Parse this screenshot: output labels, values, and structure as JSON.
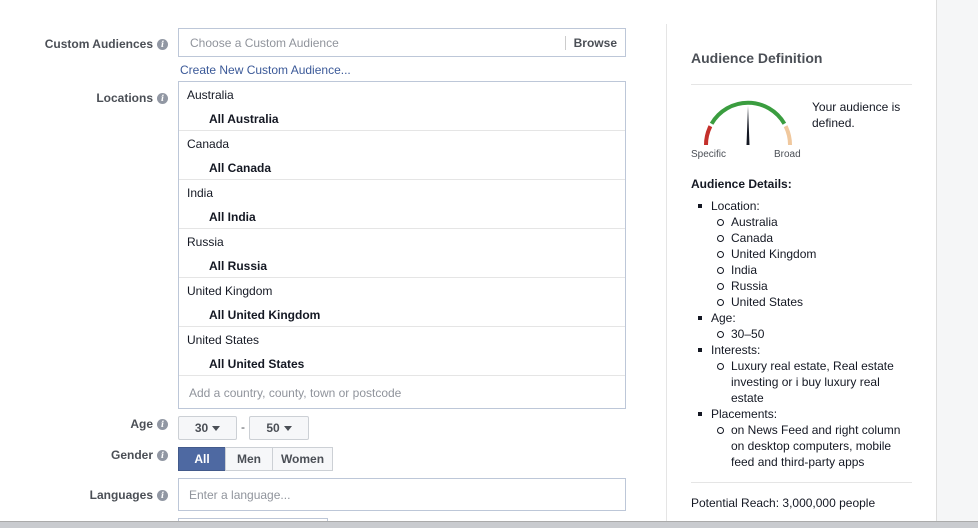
{
  "form": {
    "custom_audiences": {
      "label": "Custom Audiences",
      "placeholder": "Choose a Custom Audience",
      "browse_label": "Browse",
      "create_link": "Create New Custom Audience..."
    },
    "locations": {
      "label": "Locations",
      "groups": [
        {
          "country": "Australia",
          "scope": "All Australia"
        },
        {
          "country": "Canada",
          "scope": "All Canada"
        },
        {
          "country": "India",
          "scope": "All India"
        },
        {
          "country": "Russia",
          "scope": "All Russia"
        },
        {
          "country": "United Kingdom",
          "scope": "All United Kingdom"
        },
        {
          "country": "United States",
          "scope": "All United States"
        }
      ],
      "add_placeholder": "Add a country, county, town or postcode"
    },
    "age": {
      "label": "Age",
      "min": "30",
      "separator": "-",
      "max": "50"
    },
    "gender": {
      "label": "Gender",
      "options": [
        "All",
        "Men",
        "Women"
      ],
      "selected": "All"
    },
    "languages": {
      "label": "Languages",
      "placeholder": "Enter a language..."
    },
    "info_glyph": "i"
  },
  "panel": {
    "title": "Audience Definition",
    "gauge_status": "Your audience is defined.",
    "gauge_specific": "Specific",
    "gauge_broad": "Broad",
    "gauge_level": 0.5,
    "details_title": "Audience Details:",
    "details": [
      {
        "label": "Location:",
        "items": [
          "Australia",
          "Canada",
          "United Kingdom",
          "India",
          "Russia",
          "United States"
        ]
      },
      {
        "label": "Age:",
        "items": [
          "30–50"
        ]
      },
      {
        "label": "Interests:",
        "items": [
          "Luxury real estate, Real estate investing or i buy luxury real estate"
        ]
      },
      {
        "label": "Placements:",
        "items": [
          "on News Feed and right column on desktop computers, mobile feed and third-party apps"
        ]
      }
    ],
    "potential_reach": "Potential Reach: 3,000,000 people"
  },
  "colors": {
    "accent_blue": "#3b5998",
    "selected_segment": "#4e69a2",
    "gauge_red": "#c4302b",
    "gauge_green": "#3a9d3f",
    "gauge_orange": "#f0c89e"
  }
}
